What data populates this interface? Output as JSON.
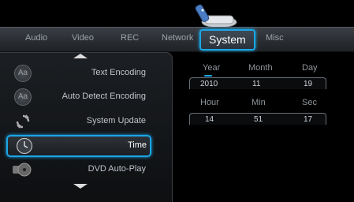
{
  "tabs": [
    {
      "label": "Audio"
    },
    {
      "label": "Video"
    },
    {
      "label": "REC"
    },
    {
      "label": "Network"
    },
    {
      "label": "System"
    },
    {
      "label": "Misc"
    }
  ],
  "active_tab": "System",
  "menu": {
    "items": [
      {
        "label": "Text Encoding",
        "icon": "aa-icon"
      },
      {
        "label": "Auto Detect Encoding",
        "icon": "aa-icon"
      },
      {
        "label": "System Update",
        "icon": "refresh-icon"
      },
      {
        "label": "Time",
        "icon": "clock-icon",
        "selected": true
      },
      {
        "label": "DVD Auto-Play",
        "icon": "disc-icon"
      }
    ]
  },
  "time": {
    "date_headers": [
      "Year",
      "Month",
      "Day"
    ],
    "date_values": [
      "2010",
      "11",
      "19"
    ],
    "time_headers": [
      "Hour",
      "Min",
      "Sec"
    ],
    "time_values": [
      "14",
      "51",
      "17"
    ]
  },
  "colors": {
    "accent": "#1ba6e6",
    "background": "#000000",
    "panel": "#1c1f23"
  }
}
